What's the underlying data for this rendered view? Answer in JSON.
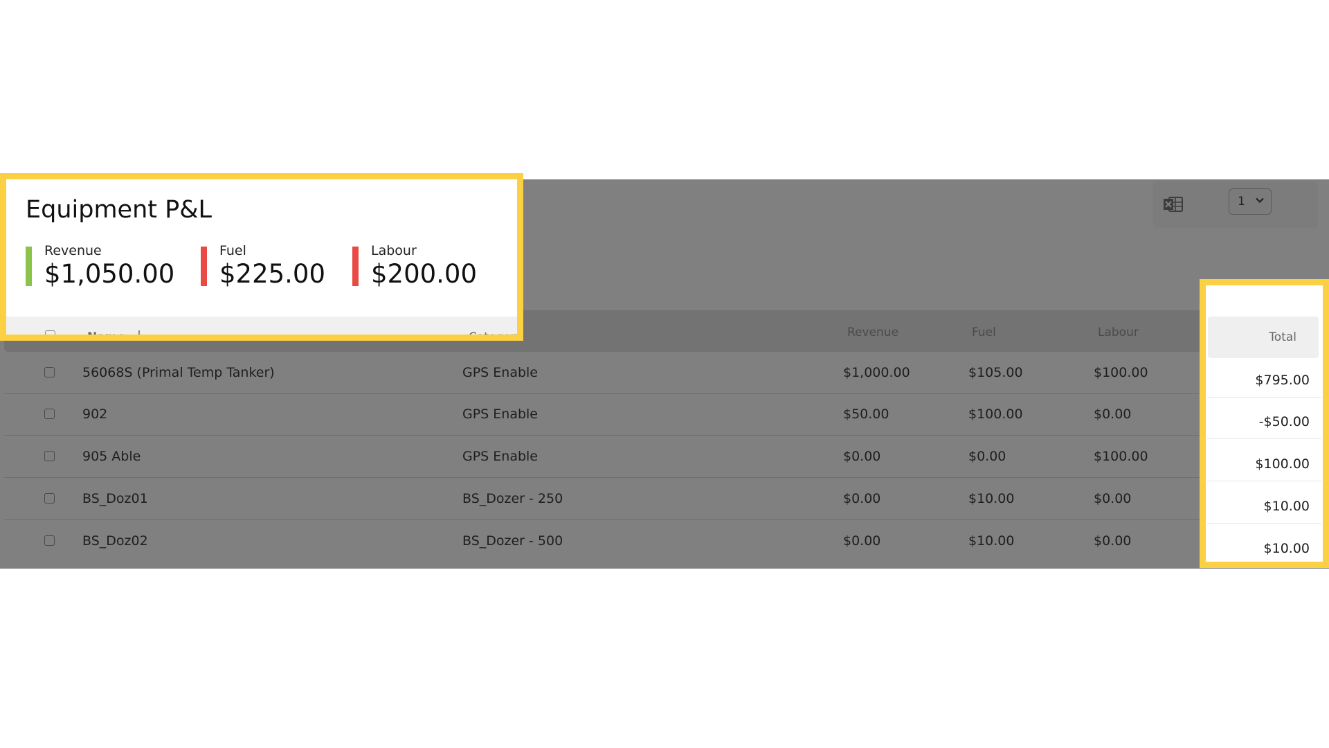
{
  "card": {
    "title": "Equipment P&L",
    "metrics": [
      {
        "label": "Revenue",
        "value": "$1,050.00",
        "color": "#8cc34a"
      },
      {
        "label": "Fuel",
        "value": "$225.00",
        "color": "#ea4a45"
      },
      {
        "label": "Labour",
        "value": "$200.00",
        "color": "#ea4a45"
      }
    ]
  },
  "toolbar": {
    "export_icon": "excel-icon",
    "page_value": "1"
  },
  "table": {
    "columns": {
      "name": "Name",
      "category": "Category",
      "revenue": "Revenue",
      "fuel": "Fuel",
      "labour": "Labour",
      "total": "Total"
    },
    "rows": [
      {
        "name": "56068S (Primal Temp Tanker)",
        "category": "GPS Enable",
        "revenue": "$1,000.00",
        "fuel": "$105.00",
        "labour": "$100.00",
        "total": "$795.00"
      },
      {
        "name": "902",
        "category": "GPS Enable",
        "revenue": "$50.00",
        "fuel": "$100.00",
        "labour": "$0.00",
        "total": "-$50.00"
      },
      {
        "name": "905 Able",
        "category": "GPS Enable",
        "revenue": "$0.00",
        "fuel": "$0.00",
        "labour": "$100.00",
        "total": "$100.00"
      },
      {
        "name": "BS_Doz01",
        "category": "BS_Dozer - 250",
        "revenue": "$0.00",
        "fuel": "$10.00",
        "labour": "$0.00",
        "total": "$10.00"
      },
      {
        "name": "BS_Doz02",
        "category": "BS_Dozer - 500",
        "revenue": "$0.00",
        "fuel": "$10.00",
        "labour": "$0.00",
        "total": "$10.00"
      }
    ]
  },
  "colors": {
    "highlight": "#fcd043",
    "overlay": "#808080"
  }
}
